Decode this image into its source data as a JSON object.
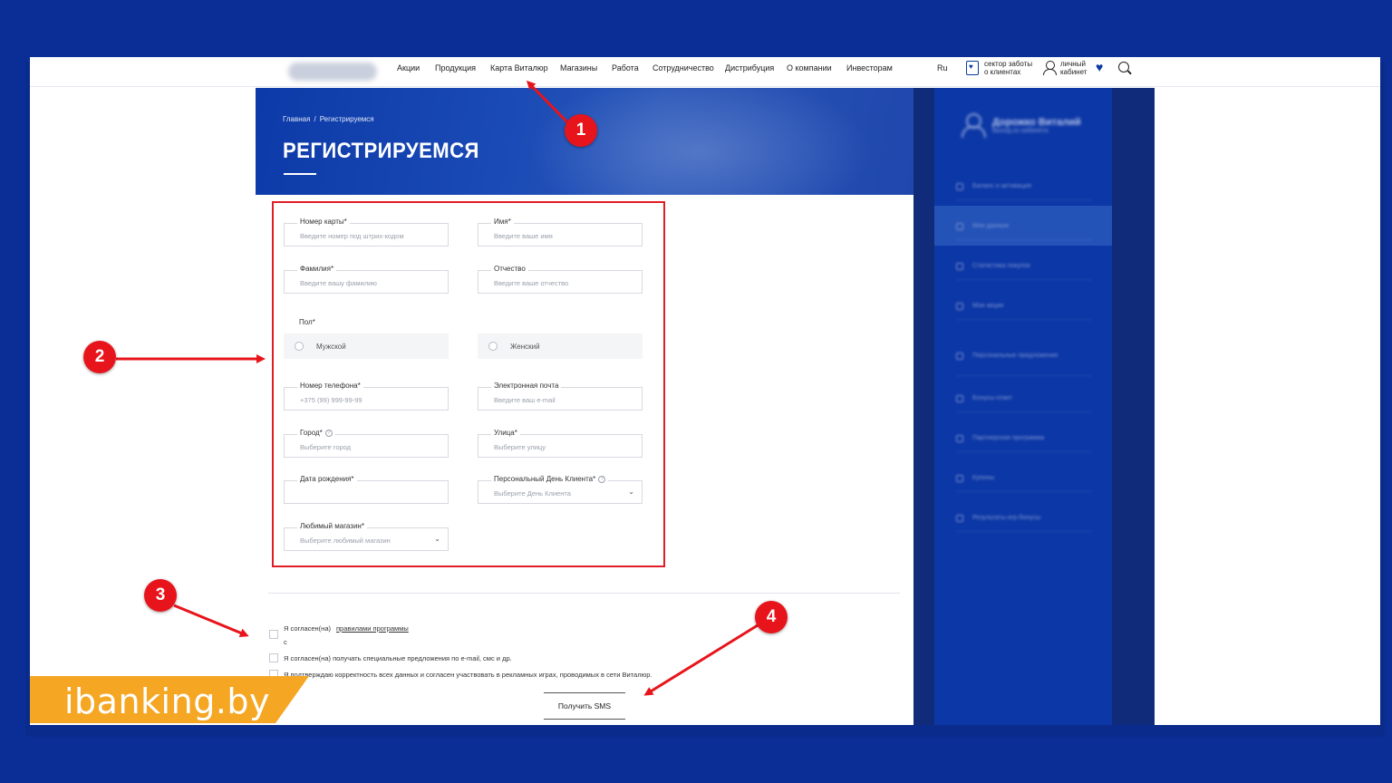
{
  "nav": {
    "items": [
      "Акции",
      "Продукция",
      "Карта Виталюр",
      "Магазины",
      "Работа",
      "Сотрудничество",
      "Дистрибуция",
      "О компании",
      "Инвесторам"
    ],
    "lang": "Ru",
    "care_line1": "сектор заботы",
    "care_line2": "о клиентах",
    "cabinet_line1": "личный",
    "cabinet_line2": "кабинет"
  },
  "hero": {
    "breadcrumb_home": "Главная",
    "breadcrumb_sep": "/",
    "breadcrumb_current": "Регистрируемся",
    "title": "РЕГИСТРИРУЕМСЯ"
  },
  "sidebar": {
    "user_name": "Дорожко Виталий",
    "user_sub": "Выход из кабинета",
    "items": [
      "Баланс и активация",
      "Мои данные",
      "Статистика покупок",
      "Мои акции",
      "Персональные предложения",
      "Бонусы-ответ",
      "Партнерская программа",
      "Купоны",
      "Результаты игр-бонусы"
    ]
  },
  "form": {
    "card": {
      "label": "Номер карты*",
      "placeholder": "Введите номер под штрих-кодом"
    },
    "first_name": {
      "label": "Имя*",
      "placeholder": "Введите ваше имя"
    },
    "last_name": {
      "label": "Фамилия*",
      "placeholder": "Введите вашу фамилию"
    },
    "patronymic": {
      "label": "Отчество",
      "placeholder": "Введите ваше отчество"
    },
    "gender_label": "Пол*",
    "gender_male": "Мужской",
    "gender_female": "Женский",
    "phone": {
      "label": "Номер телефона*",
      "placeholder": "+375 (99) 999-99-99"
    },
    "email": {
      "label": "Электронная почта",
      "placeholder": "Введите ваш e-mail"
    },
    "city": {
      "label": "Город*",
      "placeholder": "Выберите город"
    },
    "street": {
      "label": "Улица*",
      "placeholder": "Выберите улицу"
    },
    "birth": {
      "label": "Дата рождения*",
      "placeholder": ""
    },
    "client_day": {
      "label": "Персональный День Клиента*",
      "placeholder": "Выберите День Клиента"
    },
    "fav_store": {
      "label": "Любимый магазин*",
      "placeholder": "Выберите любимый магазин"
    }
  },
  "agreements": {
    "rules_text": "Я согласен(на)",
    "rules_link": "правилами программы",
    "rules_c": "с",
    "offers": "Я согласен(на) получать специальные предложения по e-mail, смс и др.",
    "confirm": "Я подтверждаю корректность всех данных и согласен участвовать в рекламных играх, проводимых в сети Виталюр."
  },
  "sms_button": "Получить SMS",
  "watermark": "ibanking.by",
  "annotations": [
    "1",
    "2",
    "3",
    "4"
  ],
  "colors": {
    "background": "#0a2d96",
    "hero": "#0c3aa8",
    "annotation_red": "#e8141b",
    "watermark": "#f5a623"
  }
}
